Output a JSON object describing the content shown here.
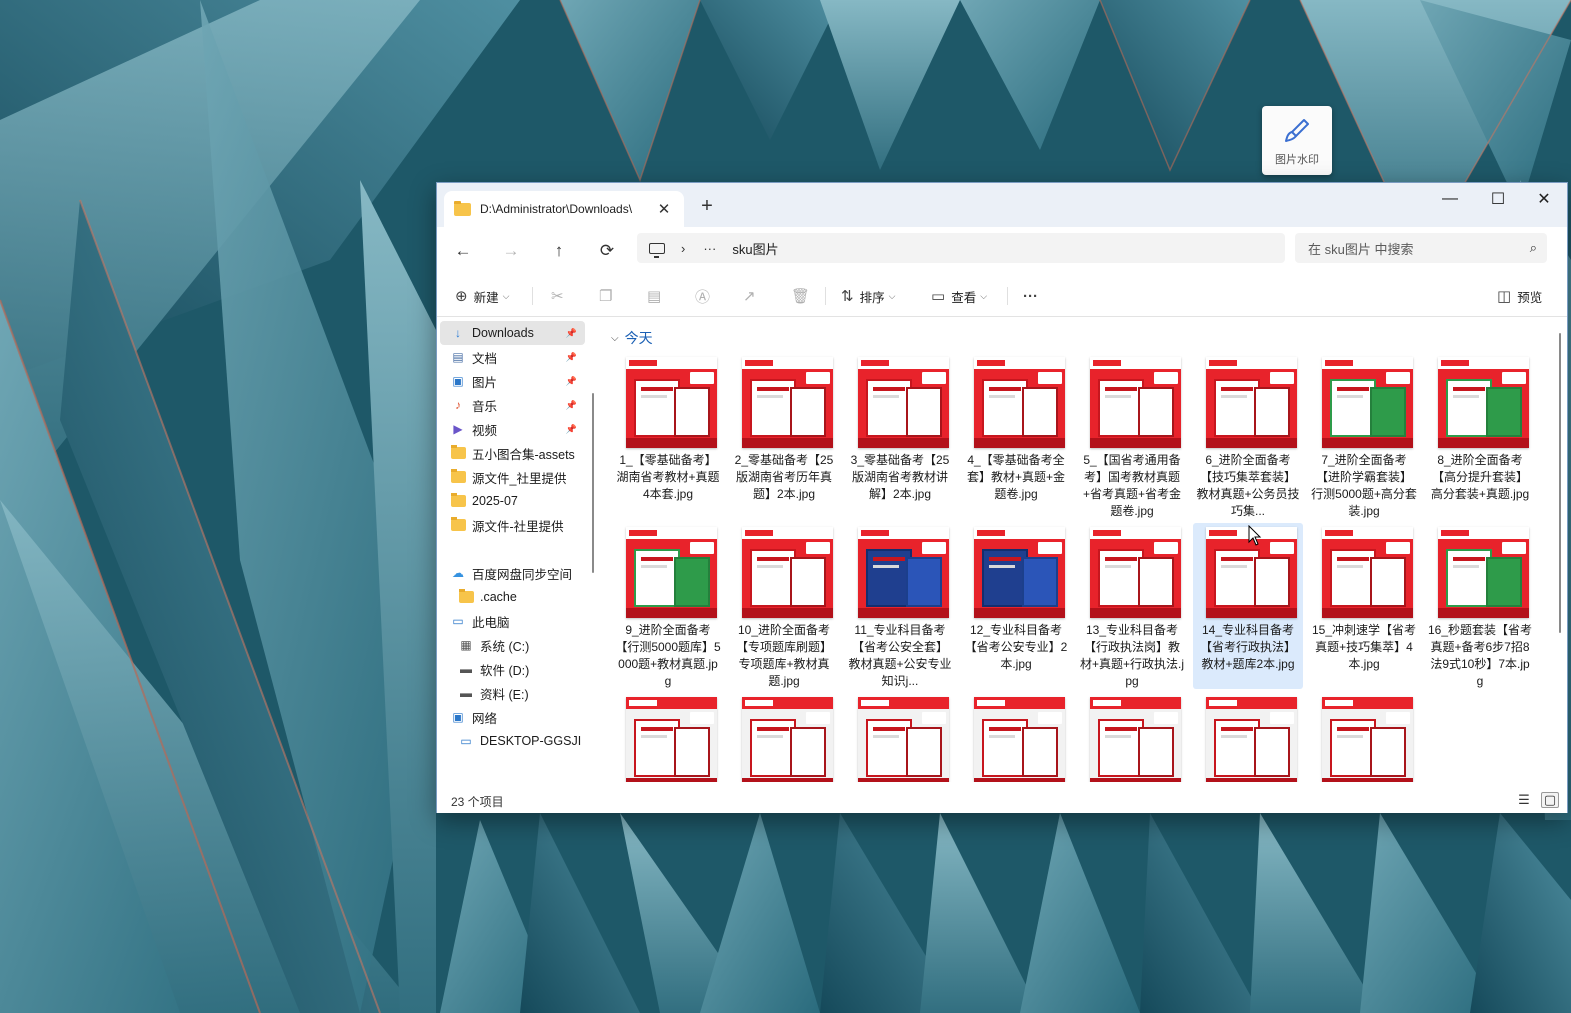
{
  "widget": {
    "label": "图片水印",
    "icon": "brush-icon"
  },
  "window": {
    "tab_title": "D:\\Administrator\\Downloads\\",
    "tab_close": "✕",
    "new_tab": "+",
    "controls": {
      "minimize": "—",
      "maximize": "☐",
      "close": "✕"
    }
  },
  "nav": {
    "back": "←",
    "forward": "→",
    "up": "↑",
    "refresh": "⟳"
  },
  "address": {
    "sep": "›",
    "more": "···",
    "crumb": "sku图片"
  },
  "search": {
    "placeholder": "在 sku图片 中搜索",
    "icon": "⌕"
  },
  "toolbar": {
    "new_label": "新建",
    "sort_label": "排序",
    "view_label": "查看",
    "more": "···",
    "preview_label": "预览"
  },
  "sidebar": {
    "items": [
      {
        "label": "Downloads",
        "icon": "download-icon",
        "pinned": true,
        "active": true
      },
      {
        "label": "文档",
        "icon": "document-icon",
        "pinned": true
      },
      {
        "label": "图片",
        "icon": "picture-icon",
        "pinned": true
      },
      {
        "label": "音乐",
        "icon": "music-icon",
        "pinned": true
      },
      {
        "label": "视频",
        "icon": "video-icon",
        "pinned": true
      },
      {
        "label": "五小图合集-assets",
        "icon": "folder-icon"
      },
      {
        "label": "源文件_社里提供",
        "icon": "folder-icon"
      },
      {
        "label": "2025-07",
        "icon": "folder-icon"
      },
      {
        "label": "源文件-社里提供",
        "icon": "folder-icon"
      },
      {
        "label": "百度网盘同步空间",
        "icon": "cloud-icon"
      },
      {
        "label": ".cache",
        "icon": "folder-icon"
      },
      {
        "label": "此电脑",
        "icon": "computer-icon"
      },
      {
        "label": "系统 (C:)",
        "icon": "drive-c-icon"
      },
      {
        "label": "软件 (D:)",
        "icon": "drive-icon"
      },
      {
        "label": "资料 (E:)",
        "icon": "drive-icon"
      },
      {
        "label": "网络",
        "icon": "network-icon"
      },
      {
        "label": "DESKTOP-GGSJI",
        "icon": "desktop-icon"
      }
    ]
  },
  "group": {
    "label": "今天",
    "chevron": "⌵"
  },
  "files": [
    {
      "name": "1_【零基础备考】湖南省考教材+真题4本套.jpg",
      "style": "red"
    },
    {
      "name": "2_零基础备考【25版湖南省考历年真题】2本.jpg",
      "style": "red"
    },
    {
      "name": "3_零基础备考【25版湖南省考教材讲解】2本.jpg",
      "style": "red"
    },
    {
      "name": "4_【零基础备考全套】教材+真题+金题卷.jpg",
      "style": "red"
    },
    {
      "name": "5_【国省考通用备考】国考教材真题+省考真题+省考金题卷.jpg",
      "style": "red"
    },
    {
      "name": "6_进阶全面备考【技巧集萃套装】教材真题+公务员技巧集...",
      "style": "red"
    },
    {
      "name": "7_进阶全面备考【进阶学霸套装】行测5000题+高分套装.jpg",
      "style": "green"
    },
    {
      "name": "8_进阶全面备考【高分提升套装】高分套装+真题.jpg",
      "style": "green"
    },
    {
      "name": "9_进阶全面备考【行测5000题库】5000题+教材真题.jpg",
      "style": "green"
    },
    {
      "name": "10_进阶全面备考【专项题库刷题】专项题库+教材真题.jpg",
      "style": "red"
    },
    {
      "name": "11_专业科目备考【省考公安全套】教材真题+公安专业知识j...",
      "style": "blue"
    },
    {
      "name": "12_专业科目备考【省考公安专业】2本.jpg",
      "style": "blue"
    },
    {
      "name": "13_专业科目备考【行政执法岗】教材+真题+行政执法.jpg",
      "style": "red"
    },
    {
      "name": "14_专业科目备考【省考行政执法】教材+题库2本.jpg",
      "style": "red",
      "selected": true
    },
    {
      "name": "15_冲刺速学【省考真题+技巧集萃】4本.jpg",
      "style": "red"
    },
    {
      "name": "16_秒题套装【省考真题+备考6步7招8法9式10秒】7本.jpg",
      "style": "green"
    },
    {
      "name": "",
      "style": "light"
    },
    {
      "name": "",
      "style": "light"
    },
    {
      "name": "",
      "style": "light"
    },
    {
      "name": "",
      "style": "light"
    },
    {
      "name": "",
      "style": "light"
    },
    {
      "name": "",
      "style": "light"
    },
    {
      "name": "",
      "style": "light"
    }
  ],
  "status": {
    "count": "23 个项目"
  },
  "colors": {
    "accent": "#1a5fb4",
    "thumb_red": "#e8232b",
    "selection": "#dbeafc"
  }
}
